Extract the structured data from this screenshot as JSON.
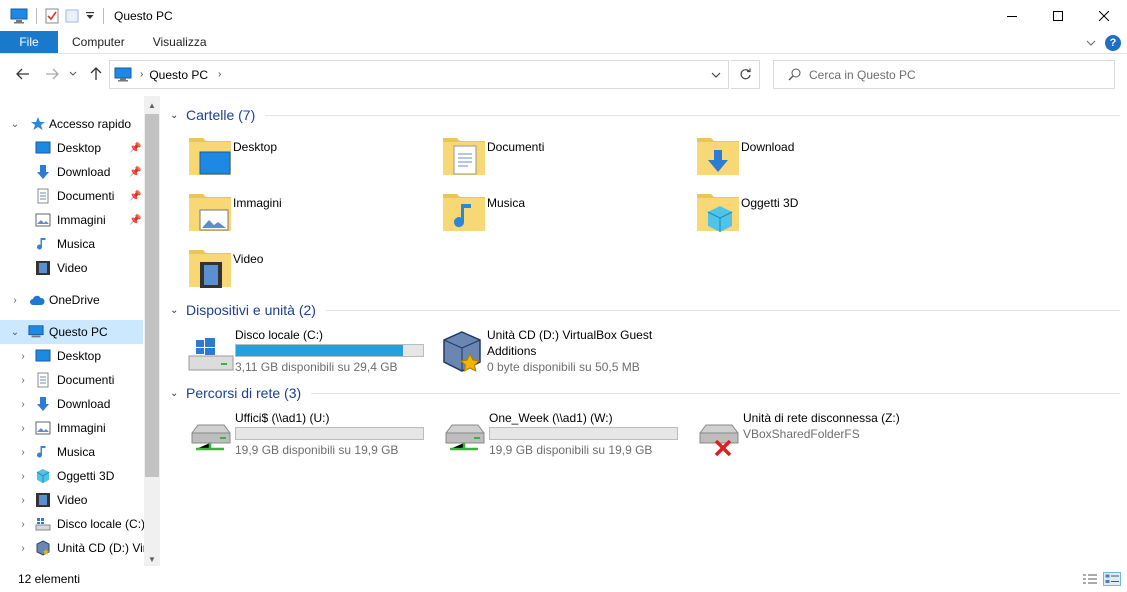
{
  "window": {
    "title": "Questo PC"
  },
  "ribbon": {
    "tabs": [
      "File",
      "Computer",
      "Visualizza"
    ]
  },
  "address": {
    "crumb": "Questo PC",
    "search_placeholder": "Cerca in Questo PC"
  },
  "nav": {
    "quick_access": "Accesso rapido",
    "quick_items": [
      "Desktop",
      "Download",
      "Documenti",
      "Immagini",
      "Musica",
      "Video"
    ],
    "onedrive": "OneDrive",
    "this_pc": "Questo PC",
    "pc_items": [
      "Desktop",
      "Documenti",
      "Download",
      "Immagini",
      "Musica",
      "Oggetti 3D",
      "Video",
      "Disco locale (C:)",
      "Unità CD (D:) Vir"
    ]
  },
  "content": {
    "groups": {
      "folders": "Cartelle (7)",
      "devices": "Dispositivi e unità (2)",
      "network": "Percorsi di rete (3)"
    },
    "folders": [
      "Desktop",
      "Documenti",
      "Download",
      "Immagini",
      "Musica",
      "Oggetti 3D",
      "Video"
    ],
    "devices": [
      {
        "name": "Disco locale (C:)",
        "free": "3,11 GB disponibili su 29,4 GB",
        "used_fraction": 0.894
      },
      {
        "name_line1": "Unità CD (D:) VirtualBox Guest",
        "name_line2": "Additions",
        "free": "0 byte disponibili su 50,5 MB"
      }
    ],
    "network": [
      {
        "name": "Uffici$ (\\\\ad1) (U:)",
        "free": "19,9 GB disponibili su 19,9 GB",
        "used_fraction": 0.0
      },
      {
        "name": "One_Week (\\\\ad1) (W:)",
        "free": "19,9 GB disponibili su 19,9 GB",
        "used_fraction": 0.0
      },
      {
        "name": "Unità di rete disconnessa (Z:)",
        "sub": "VBoxSharedFolderFS"
      }
    ]
  },
  "status": {
    "count": "12 elementi"
  },
  "colors": {
    "accent": "#1979ca",
    "selection": "#cce8ff",
    "group_title": "#1c3f94",
    "bar_fill": "#26a0da"
  }
}
